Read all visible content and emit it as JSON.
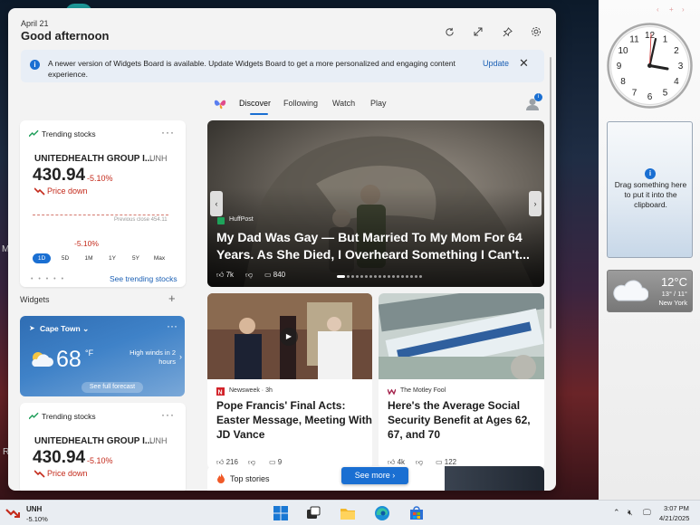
{
  "header": {
    "date": "April 21",
    "greeting": "Good afternoon"
  },
  "notice": {
    "message": "A newer version of Widgets Board is available. Update Widgets Board to get a more personalized and engaging content experience.",
    "update_label": "Update"
  },
  "trending1": {
    "title": "Trending stocks",
    "name": "UNITEDHEALTH GROUP I...",
    "ticker": "UNH",
    "price": "430.94",
    "change": "-5.10%",
    "direction": "Price down",
    "prev_close": "Previous close 454.11",
    "chart_pct": "-5.10%",
    "ranges": [
      "1D",
      "5D",
      "1M",
      "1Y",
      "5Y",
      "Max"
    ],
    "selected_range": "1D",
    "see_more": "See trending stocks"
  },
  "widgets_label": "Widgets",
  "weather": {
    "location": "Cape Town",
    "temp": "68",
    "unit": "°F",
    "alert": "High winds in 2 hours",
    "forecast_btn": "See full forecast"
  },
  "trending2": {
    "title": "Trending stocks",
    "name": "UNITEDHEALTH GROUP I...",
    "ticker": "UNH",
    "price": "430.94",
    "change": "-5.10%",
    "direction": "Price down"
  },
  "tabs": [
    "Discover",
    "Following",
    "Watch",
    "Play"
  ],
  "active_tab": "Discover",
  "profile_badge": "i",
  "hero": {
    "source": "HuffPost",
    "title": "My Dad Was Gay — But Married To My Mom For 64 Years. As She Died, I Overheard Something I Can't...",
    "likes": "7k",
    "comments": "840"
  },
  "article1": {
    "source": "Newsweek · 3h",
    "title": "Pope Francis' Final Acts: Easter Message, Meeting With JD Vance",
    "likes": "216",
    "comments": "9"
  },
  "article2": {
    "source": "The Motley Fool",
    "title": "Here's the Average Social Security Benefit at Ages 62, 67, and 70",
    "likes": "4k",
    "comments": "122"
  },
  "top_stories": {
    "label": "Top stories",
    "see_more": "See more"
  },
  "clipboard": {
    "text": "Drag something here to put it into the clipboard."
  },
  "gadget_weather": {
    "temp": "12°C",
    "range": "13° / 11°",
    "location": "New York"
  },
  "clock_numbers": [
    "12",
    "1",
    "2",
    "3",
    "4",
    "5",
    "6",
    "7",
    "8",
    "9",
    "10",
    "11"
  ],
  "taskbar": {
    "ticker": "UNH",
    "change": "-5.10%",
    "time": "3:07 PM",
    "date": "4/21/2025"
  },
  "colors": {
    "accent": "#1a6fd2",
    "negative": "#c42b1c"
  }
}
